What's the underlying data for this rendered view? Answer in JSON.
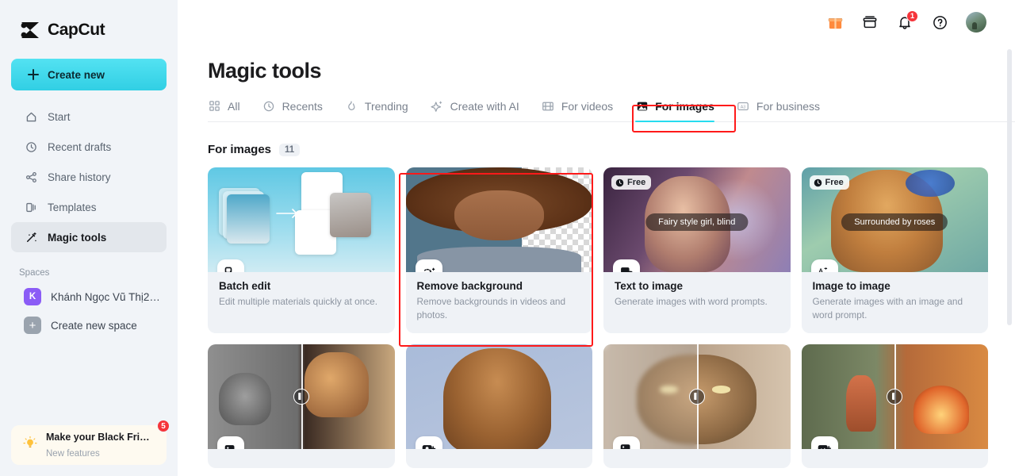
{
  "brand": {
    "name": "CapCut",
    "logo_icon": "capcut-logo-icon"
  },
  "sidebar": {
    "create_new": {
      "label": "Create new",
      "icon": "plus-icon"
    },
    "items": [
      {
        "label": "Start",
        "icon": "home-icon",
        "active": false
      },
      {
        "label": "Recent drafts",
        "icon": "clock-icon",
        "active": false
      },
      {
        "label": "Share history",
        "icon": "share-icon",
        "active": false
      },
      {
        "label": "Templates",
        "icon": "templates-icon",
        "active": false
      },
      {
        "label": "Magic tools",
        "icon": "magic-wand-icon",
        "active": true
      }
    ],
    "spaces_title": "Spaces",
    "spaces": [
      {
        "label": "Khánh Ngọc Vũ Thị2…",
        "avatar_letter": "K",
        "avatar_color": "#8B5CF6"
      },
      {
        "label": "Create new space",
        "avatar_letter": "+",
        "avatar_color": "#9AA3AE"
      }
    ],
    "promo": {
      "title": "Make your Black Fri…",
      "subtitle": "New features",
      "badge": "5",
      "icon": "lightbulb-icon",
      "badge_color": "#F5353B"
    }
  },
  "topbar": {
    "icons": [
      {
        "name": "gift-icon",
        "label": "Gifts"
      },
      {
        "name": "archive-box-icon",
        "label": "Storage"
      },
      {
        "name": "bell-icon",
        "label": "Notifications",
        "badge": "1"
      },
      {
        "name": "help-circle-icon",
        "label": "Help"
      }
    ],
    "avatar_name": "user-avatar"
  },
  "header": {
    "title": "Magic tools"
  },
  "tabs": [
    {
      "label": "All",
      "icon": "grid-icon",
      "active": false
    },
    {
      "label": "Recents",
      "icon": "clock-icon",
      "active": false
    },
    {
      "label": "Trending",
      "icon": "flame-icon",
      "active": false
    },
    {
      "label": "Create with AI",
      "icon": "sparkle-icon",
      "active": false
    },
    {
      "label": "For videos",
      "icon": "film-icon",
      "active": false
    },
    {
      "label": "For images",
      "icon": "image-icon",
      "active": true
    },
    {
      "label": "For business",
      "icon": "ad-icon",
      "active": false
    }
  ],
  "section": {
    "title": "For images",
    "count": "11"
  },
  "highlights": {
    "color": "#FF1A1A",
    "tab_target": "For images",
    "card_target": "Remove background"
  },
  "cards": [
    {
      "title": "Batch edit",
      "desc": "Edit multiple materials quickly at once.",
      "chip_icon": "batch-edit-icon",
      "badge": null,
      "prompt": null
    },
    {
      "title": "Remove background",
      "desc": "Remove backgrounds in videos and photos.",
      "chip_icon": "remove-background-icon",
      "badge": null,
      "prompt": null,
      "highlighted": true
    },
    {
      "title": "Text to image",
      "desc": "Generate images with word prompts.",
      "chip_icon": "text-to-image-icon",
      "badge": "Free",
      "prompt": "Fairy style girl, blind"
    },
    {
      "title": "Image to image",
      "desc": "Generate images with an image and word prompt.",
      "chip_icon": "image-to-image-icon",
      "badge": "Free",
      "prompt": "Surrounded by roses"
    }
  ],
  "cards_row2": [
    {
      "chip_icon": "colorize-photo-icon"
    },
    {
      "chip_icon": "portrait-retouch-icon"
    },
    {
      "chip_icon": "image-upscaler-4k-icon"
    },
    {
      "chip_icon": "image-enhance-icon"
    }
  ],
  "colors": {
    "accent_cyan": "#27DCEF",
    "sidebar_bg": "#F1F4F8",
    "card_bg": "#EFF2F6",
    "highlight_red": "#FF1A1A",
    "badge_red": "#F5353B",
    "space_purple": "#8B5CF6"
  }
}
